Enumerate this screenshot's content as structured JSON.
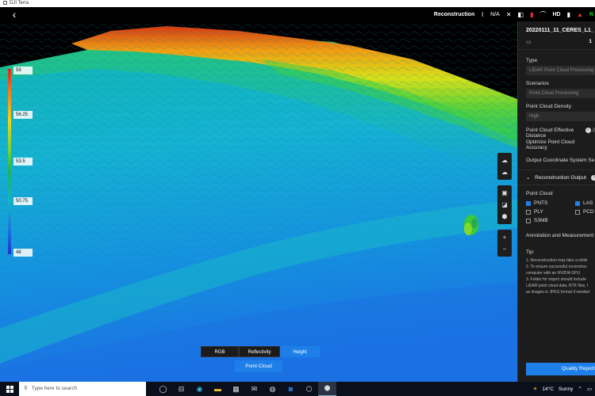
{
  "window": {
    "title": "DJI Terra"
  },
  "topbar": {
    "back_icon": "chevron-left-icon",
    "mode": "Reconstruction",
    "signal_value": "N/A",
    "hd_label": "HD",
    "n_label": "N"
  },
  "legend": {
    "ticks": [
      "59",
      "56.25",
      "53.5",
      "50.75",
      "48"
    ]
  },
  "view_modes": {
    "tabs": [
      "RGB",
      "Reflectivity",
      "Height"
    ],
    "active": "Height",
    "point_cloud_button": "Point Cloud"
  },
  "panel": {
    "title": "20220111_11_CERES_L1_",
    "count": "1",
    "type_label": "Type",
    "type_value": "LiDAR Point Cloud Processing",
    "scenarios_label": "Scenarios",
    "scenarios_value": "Point Cloud Processing",
    "density_label": "Point Cloud Density",
    "density_value": "High",
    "effective_label_1": "Point Cloud Effective",
    "effective_label_2": "Distance",
    "effective_value": "2",
    "optimize_label_1": "Optimize Point Cloud",
    "optimize_label_2": "Accuracy",
    "output_coord_label": "Output Coordinate System Se",
    "recon_output_label": "Reconstruction Output",
    "point_cloud_label": "Point Cloud",
    "formats": [
      {
        "name": "PNTS",
        "checked": true
      },
      {
        "name": "LAS",
        "checked": true
      },
      {
        "name": "PLY",
        "checked": false
      },
      {
        "name": "PCD",
        "checked": false
      },
      {
        "name": "S3MB",
        "checked": false
      }
    ],
    "annotation_label": "Annotation and Measurement",
    "tip_title": "Tip:",
    "tips": [
      "1. Reconstruction may take a while",
      "2. To ensure successful reconstruc",
      "computer with an NVIDIA GPU",
      "3. Folder for import should include",
      "LiDAR point cloud data, RTK files, I",
      "as images in JPEG format if needed"
    ],
    "quality_button": "Quality Report"
  },
  "taskbar": {
    "search_placeholder": "Type here to search",
    "weather_temp": "14°C",
    "weather_text": "Sunny"
  }
}
